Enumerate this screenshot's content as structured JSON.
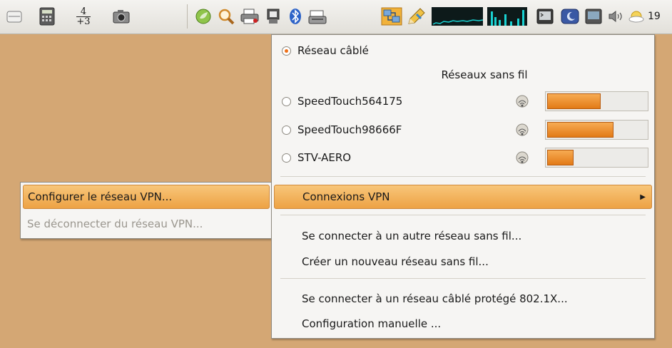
{
  "panel": {
    "fraction_bottom": "+3",
    "fraction_top": "4",
    "clock_fragment": "19"
  },
  "main_menu": {
    "wired_label": "Réseau câblé",
    "wireless_header": "Réseaux sans fil",
    "networks": [
      {
        "name": "SpeedTouch564175",
        "strength_percent": 55
      },
      {
        "name": "SpeedTouch98666F",
        "strength_percent": 68
      },
      {
        "name": "STV-AERO",
        "strength_percent": 29
      }
    ],
    "vpn_connections_label": "Connexions VPN",
    "connect_other_label": "Se connecter à un autre réseau sans fil...",
    "create_new_label": "Créer un nouveau réseau sans fil...",
    "connect_8021x_label": "Se connecter à un réseau câblé protégé 802.1X...",
    "manual_config_label": "Configuration manuelle ..."
  },
  "vpn_submenu": {
    "configure_label": "Configurer le réseau VPN...",
    "disconnect_label": "Se déconnecter du réseau VPN..."
  },
  "colors": {
    "desktop": "#d4a774",
    "highlight": "#eda244",
    "radio_active": "#ee6f18"
  }
}
